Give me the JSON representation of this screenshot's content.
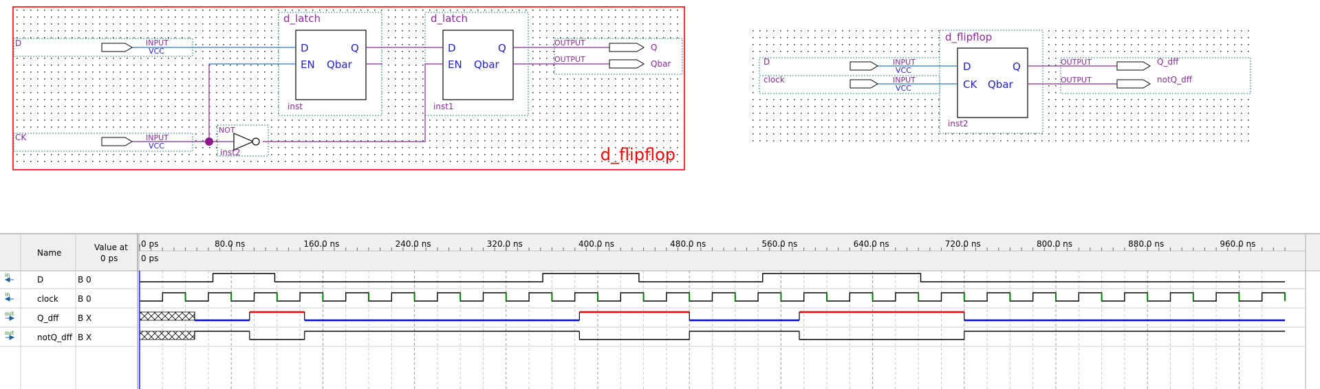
{
  "schematic": {
    "latch1": {
      "title": "d_latch",
      "pin_d": "D",
      "pin_en": "EN",
      "pin_q": "Q",
      "pin_qbar": "Qbar",
      "inst": "inst"
    },
    "latch2": {
      "title": "d_latch",
      "pin_d": "D",
      "pin_en": "EN",
      "pin_q": "Q",
      "pin_qbar": "Qbar",
      "inst": "inst1"
    },
    "input_d": {
      "name": "D",
      "type": "INPUT",
      "default": "VCC"
    },
    "input_ck": {
      "name": "CK",
      "type": "INPUT",
      "default": "VCC"
    },
    "not_gate": {
      "type": "NOT",
      "inst": "inst2"
    },
    "output_q": {
      "type": "OUTPUT",
      "name": "Q"
    },
    "output_qbar": {
      "type": "OUTPUT",
      "name": "Qbar"
    },
    "group_label": "d_flipflop"
  },
  "top_level": {
    "block": {
      "title": "d_flipflop",
      "pin_d": "D",
      "pin_ck": "CK",
      "pin_q": "Q",
      "pin_qbar": "Qbar",
      "inst": "inst2"
    },
    "input_d": {
      "name": "D",
      "type": "INPUT",
      "default": "VCC"
    },
    "input_clock": {
      "name": "clock",
      "type": "INPUT",
      "default": "VCC"
    },
    "output_q": {
      "type": "OUTPUT",
      "name": "Q_dff"
    },
    "output_qbar": {
      "type": "OUTPUT",
      "name": "notQ_dff"
    }
  },
  "waveform": {
    "col_name": "Name",
    "col_value": "Value at",
    "col_value2": "0 ps",
    "cursor_label": "0 ps",
    "time_ticks": [
      "0 ps",
      "80.0 ns",
      "160.0 ns",
      "240.0 ns",
      "320.0 ns",
      "400.0 ns",
      "480.0 ns",
      "560.0 ns",
      "640.0 ns",
      "720.0 ns",
      "800.0 ns",
      "880.0 ns",
      "960.0 ns"
    ],
    "signals": [
      {
        "dir": "in",
        "name": "D",
        "value": "B 0"
      },
      {
        "dir": "in",
        "name": "clock",
        "value": "B 0"
      },
      {
        "dir": "out",
        "name": "Q_dff",
        "value": "B X"
      },
      {
        "dir": "out",
        "name": "notQ_dff",
        "value": "B X"
      }
    ],
    "colors": {
      "clock_edge": "#008000",
      "q_high": "#ff0000",
      "q_low": "#0000ff"
    }
  },
  "chart_data": {
    "type": "timing",
    "time_unit": "ns",
    "x_range": [
      0,
      1000
    ],
    "clock_period_ns": 40,
    "D_transitions": [
      [
        0,
        0
      ],
      [
        64,
        1
      ],
      [
        118,
        0
      ],
      [
        352,
        1
      ],
      [
        436,
        0
      ],
      [
        544,
        1
      ],
      [
        682,
        0
      ]
    ],
    "Q_transitions": [
      [
        0,
        "X"
      ],
      [
        48,
        0
      ],
      [
        96,
        1
      ],
      [
        144,
        0
      ],
      [
        384,
        1
      ],
      [
        480,
        0
      ],
      [
        576,
        1
      ],
      [
        720,
        0
      ]
    ]
  }
}
